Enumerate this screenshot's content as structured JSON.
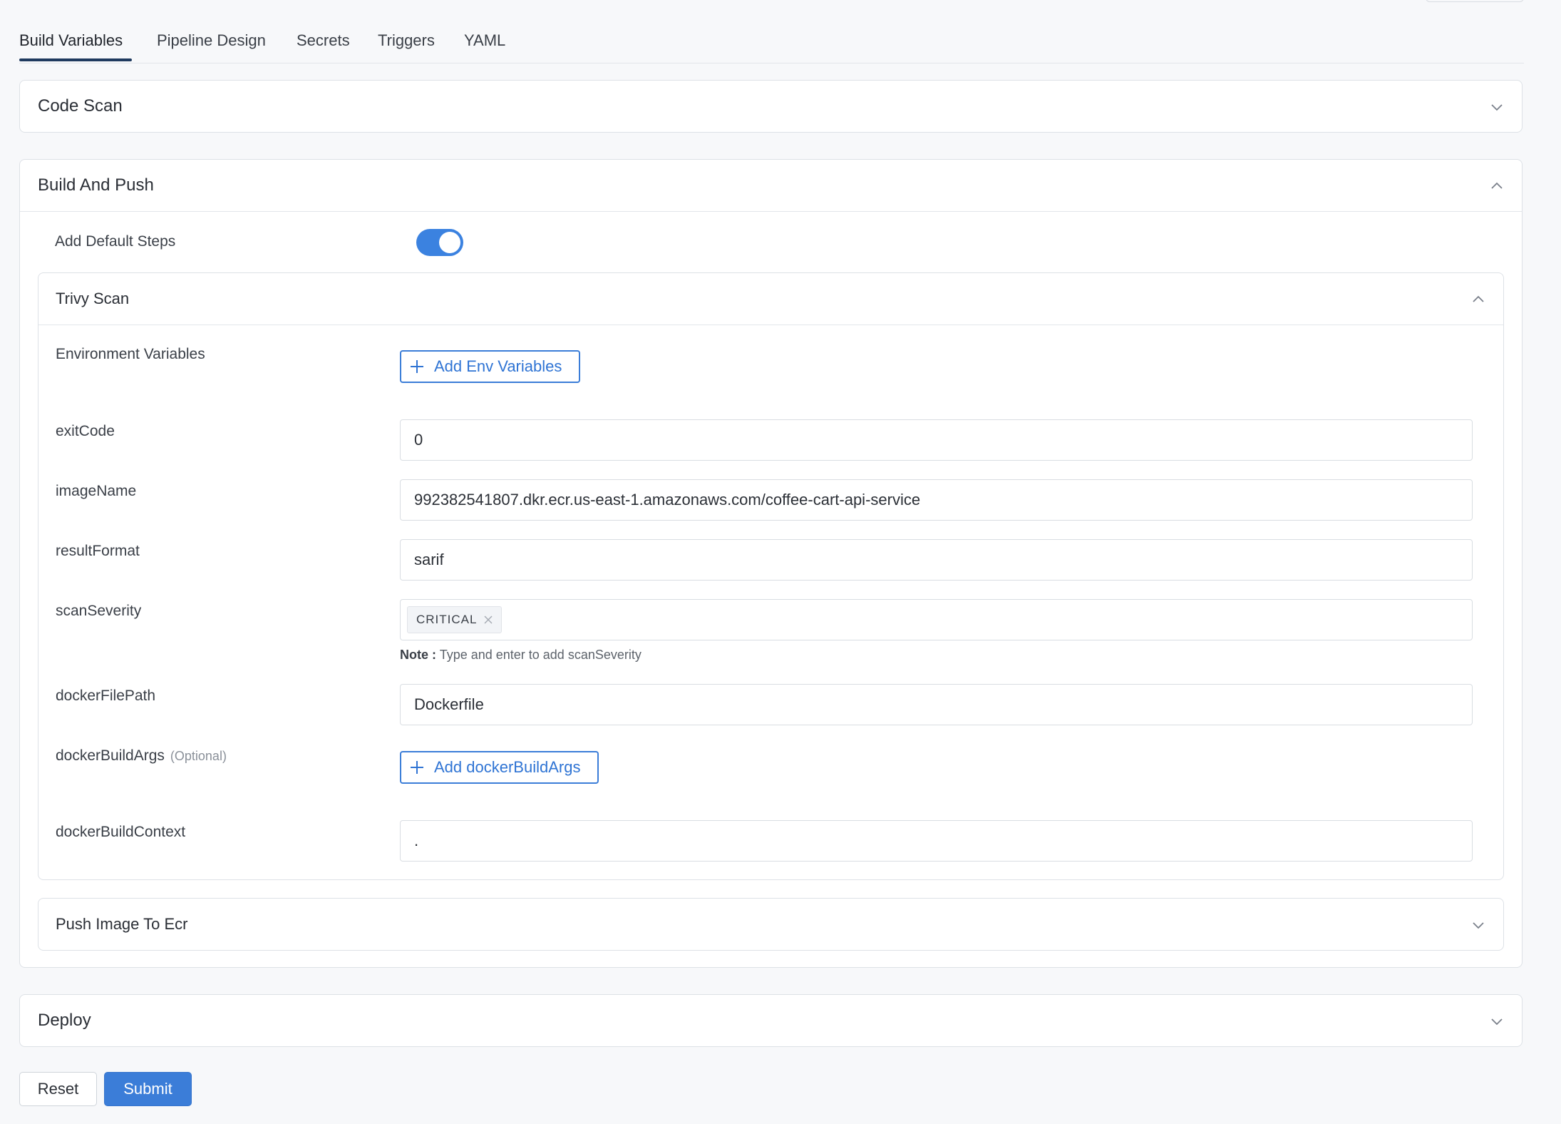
{
  "tabs": [
    {
      "label": "Build Variables",
      "active": true
    },
    {
      "label": "Pipeline Design"
    },
    {
      "label": "Secrets"
    },
    {
      "label": "Triggers"
    },
    {
      "label": "YAML"
    }
  ],
  "sections": {
    "code_scan": {
      "title": "Code Scan",
      "expanded": false
    },
    "build_and_push": {
      "title": "Build And Push",
      "expanded": true,
      "add_default_steps": {
        "label": "Add Default Steps",
        "enabled": true
      },
      "trivy_scan": {
        "title": "Trivy Scan",
        "expanded": true,
        "env_vars": {
          "label": "Environment Variables",
          "button": "Add Env Variables"
        },
        "exit_code": {
          "label": "exitCode",
          "value": "0"
        },
        "image_name": {
          "label": "imageName",
          "value": "992382541807.dkr.ecr.us-east-1.amazonaws.com/coffee-cart-api-service"
        },
        "result_format": {
          "label": "resultFormat",
          "value": "sarif"
        },
        "scan_severity": {
          "label": "scanSeverity",
          "tags": [
            "CRITICAL"
          ],
          "note_prefix": "Note :",
          "note_text": "Type and enter to add scanSeverity"
        },
        "docker_file_path": {
          "label": "dockerFilePath",
          "value": "Dockerfile"
        },
        "docker_build_args": {
          "label": "dockerBuildArgs",
          "optional": "(Optional)",
          "button": "Add dockerBuildArgs"
        },
        "docker_build_context": {
          "label": "dockerBuildContext",
          "value": "."
        }
      },
      "push_image": {
        "title": "Push Image To Ecr",
        "expanded": false
      }
    },
    "deploy": {
      "title": "Deploy",
      "expanded": false
    }
  },
  "actions": {
    "reset": "Reset",
    "submit": "Submit"
  },
  "colors": {
    "accent": "#3b7dd8",
    "toggle_on": "#3b82e0",
    "tab_underline": "#1f3a5f"
  },
  "icons": {
    "expand": "chevron-down-icon",
    "collapse": "chevron-up-icon",
    "add": "plus-icon",
    "remove_tag": "close-icon"
  }
}
